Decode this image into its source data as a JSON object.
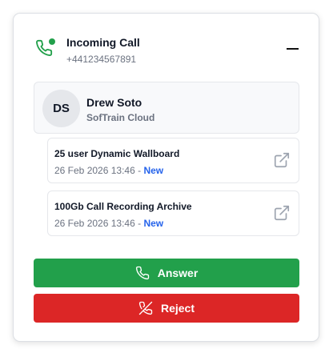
{
  "call": {
    "title": "Incoming Call",
    "number": "+441234567891"
  },
  "contact": {
    "initials": "DS",
    "name": "Drew Soto",
    "company": "SofTrain Cloud"
  },
  "tickets": [
    {
      "title": "25 user Dynamic Wallboard",
      "date": "26 Feb 2026 13:46",
      "separator": " - ",
      "status": "New"
    },
    {
      "title": "100Gb Call Recording Archive",
      "date": "26 Feb 2026 13:46",
      "separator": " - ",
      "status": "New"
    }
  ],
  "actions": {
    "answer_label": "Answer",
    "reject_label": "Reject"
  },
  "icons": {
    "header": "phone-icon",
    "minimize": "minus-icon",
    "ticket_open": "external-link-icon",
    "answer": "phone-icon",
    "reject": "phone-off-icon"
  },
  "colors": {
    "answer": "#22a04b",
    "reject": "#dc2626",
    "status_new": "#2563eb",
    "online_dot": "#22a04b"
  }
}
